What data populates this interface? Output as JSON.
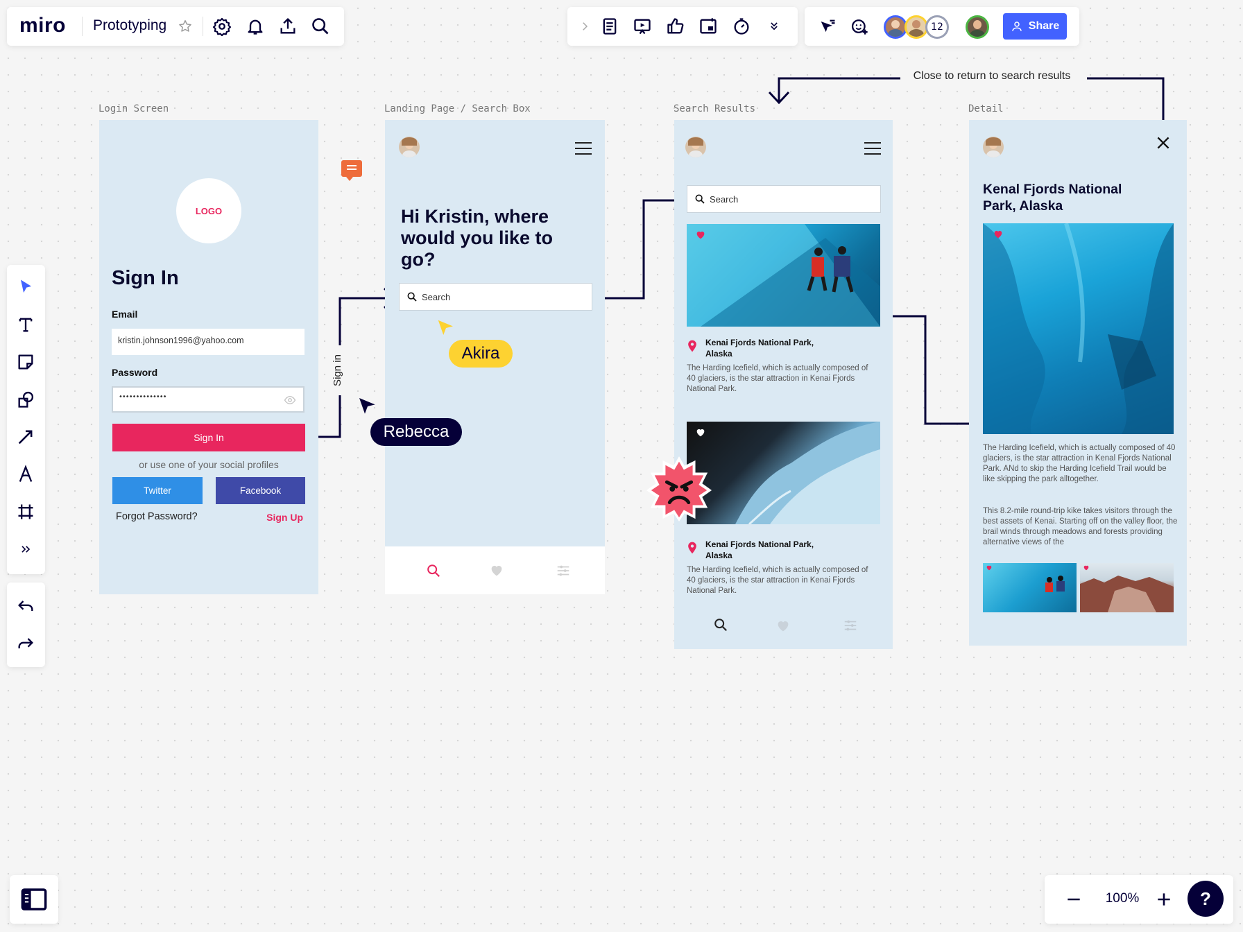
{
  "app": {
    "logo": "miro",
    "board_title": "Prototyping"
  },
  "toolbar": {
    "share_label": "Share",
    "collaborator_count": "12"
  },
  "zoom": {
    "level": "100%",
    "help": "?"
  },
  "annotation": {
    "close_note": "Close to return to search results"
  },
  "frames": {
    "login": {
      "label": "Login Screen",
      "logo": "LOGO",
      "title": "Sign In",
      "email_label": "Email",
      "email_value": "kristin.johnson1996@yahoo.com",
      "password_label": "Password",
      "password_value": "••••••••••••••",
      "signin_button": "Sign In",
      "social_text": "or use one of your social profiles",
      "twitter": "Twitter",
      "facebook": "Facebook",
      "forgot": "Forgot Password?",
      "signup": "Sign Up"
    },
    "landing": {
      "label": "Landing Page / Search Box",
      "greeting": "Hi Kristin, where would you like to go?",
      "search_placeholder": "Search"
    },
    "results": {
      "label": "Search Results",
      "search_placeholder": "Search",
      "items": [
        {
          "title": "Kenai Fjords National Park, Alaska",
          "description": "The Harding Icefield, which is actually composed of 40 glaciers, is the star attraction in Kenai Fjords National Park."
        },
        {
          "title": "Kenai Fjords National Park, Alaska",
          "description": "The Harding Icefield, which is actually composed of 40 glaciers, is the star attraction in Kenai Fjords National Park."
        }
      ]
    },
    "detail": {
      "label": "Detail",
      "title": "Kenal Fjords National Park, Alaska",
      "paragraph1": "The Harding Icefield, which is actually composed of 40 glaciers, is the star attraction in Kenal Fjords National Park. ANd to skip the Harding Icefield Trail would be like skipping the park alltogether.",
      "paragraph2": "This 8.2-mile round-trip kike takes visitors through the best assets of Kenai. Starting off on the valley floor, the brail winds through meadows and forests providing alternative views of the"
    }
  },
  "connector": {
    "signin_label": "Sign in"
  },
  "cursors": {
    "akira": "Akira",
    "rebecca": "Rebecca"
  },
  "colors": {
    "accent_blue": "#4262ff",
    "pink": "#e8265e",
    "twitter": "#2f8fe6",
    "facebook": "#3f4aa8",
    "frame_bg": "#dbe9f3",
    "akira": "#fdd231",
    "rebecca": "#050038"
  }
}
